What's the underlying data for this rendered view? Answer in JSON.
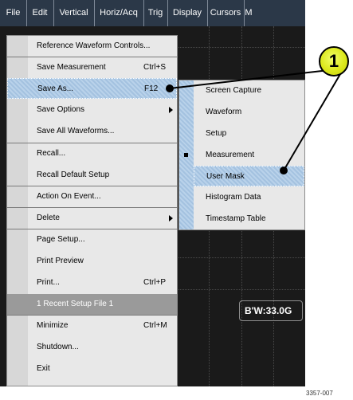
{
  "menubar": {
    "items": [
      {
        "label": "File"
      },
      {
        "label": "Edit"
      },
      {
        "label": "Vertical"
      },
      {
        "label": "Horiz/Acq"
      },
      {
        "label": "Trig"
      },
      {
        "label": "Display"
      },
      {
        "label": "Cursors"
      },
      {
        "label": "M"
      }
    ]
  },
  "file_menu": {
    "items": [
      {
        "label": "Reference Waveform Controls...",
        "shortcut": ""
      },
      {
        "label": "Save Measurement",
        "shortcut": "Ctrl+S"
      },
      {
        "label": "Save As...",
        "shortcut": "F12"
      },
      {
        "label": "Save Options",
        "shortcut": ""
      },
      {
        "label": "Save All Waveforms...",
        "shortcut": ""
      },
      {
        "label": "Recall...",
        "shortcut": ""
      },
      {
        "label": "Recall Default Setup",
        "shortcut": ""
      },
      {
        "label": "Action On Event...",
        "shortcut": ""
      },
      {
        "label": "Delete",
        "shortcut": ""
      },
      {
        "label": "Page Setup...",
        "shortcut": ""
      },
      {
        "label": "Print Preview",
        "shortcut": ""
      },
      {
        "label": "Print...",
        "shortcut": "Ctrl+P"
      },
      {
        "label": "1 Recent Setup File 1",
        "shortcut": ""
      },
      {
        "label": "Minimize",
        "shortcut": "Ctrl+M"
      },
      {
        "label": "Shutdown...",
        "shortcut": ""
      },
      {
        "label": "Exit",
        "shortcut": ""
      }
    ]
  },
  "save_as_submenu": {
    "items": [
      {
        "label": "Screen Capture"
      },
      {
        "label": "Waveform"
      },
      {
        "label": "Setup"
      },
      {
        "label": "Measurement"
      },
      {
        "label": "User Mask"
      },
      {
        "label": "Histogram Data"
      },
      {
        "label": "Timestamp Table"
      }
    ]
  },
  "readout": {
    "text": "B'W:33.0G"
  },
  "callout": {
    "number": "1"
  },
  "figure_ref": "3357-007",
  "colors": {
    "menubar": "#2b3848",
    "menu_bg": "#e8e8e8",
    "highlight": "#b9d2ea",
    "recent_file_bg": "#9a9a9a",
    "callout": "#dce81c",
    "screen": "#1a1a1a"
  }
}
